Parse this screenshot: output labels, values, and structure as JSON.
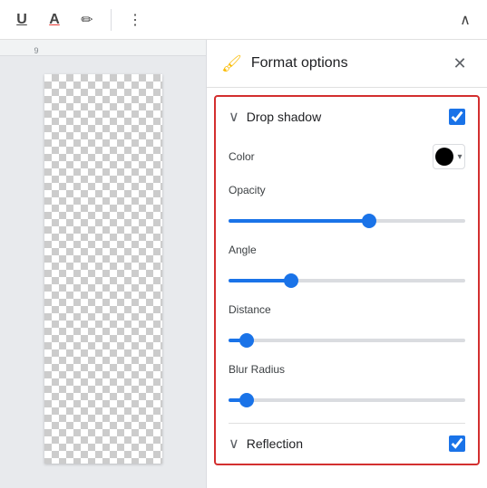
{
  "toolbar": {
    "underline_label": "U",
    "font_color_label": "A",
    "highlight_label": "✏",
    "more_label": "⋮",
    "collapse_label": "∧"
  },
  "ruler": {
    "marks": [
      "9"
    ]
  },
  "panel": {
    "title": "Format options",
    "close_label": "✕",
    "icon": "🖌",
    "sections": [
      {
        "id": "drop-shadow",
        "title": "Drop shadow",
        "checked": true,
        "expanded": true,
        "options": [
          {
            "label": "Color",
            "type": "color",
            "value": "#000000"
          },
          {
            "label": "Opacity",
            "type": "slider",
            "value": 60,
            "class": "slider-opacity"
          },
          {
            "label": "Angle",
            "type": "slider",
            "value": 25,
            "class": "slider-angle"
          },
          {
            "label": "Distance",
            "type": "slider",
            "value": 5,
            "class": "slider-distance"
          },
          {
            "label": "Blur Radius",
            "type": "slider",
            "value": 5,
            "class": "slider-blur"
          }
        ]
      },
      {
        "id": "reflection",
        "title": "Reflection",
        "checked": true,
        "expanded": false
      }
    ]
  }
}
